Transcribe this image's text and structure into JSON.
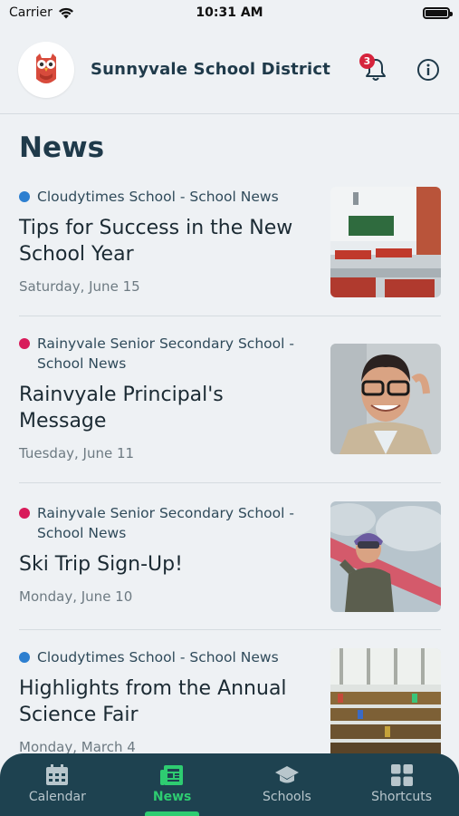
{
  "status_bar": {
    "carrier": "Carrier",
    "time": "10:31 AM"
  },
  "header": {
    "title": "Sunnyvale School District",
    "notification_count": "3"
  },
  "page_title": "News",
  "news": [
    {
      "source": "Cloudytimes School - School News",
      "dot_color": "#2d7fd0",
      "title": "Tips for Success in the New School Year",
      "date": "Saturday, June 15",
      "image": "classroom"
    },
    {
      "source": "Rainyvale Senior Secondary School - School News",
      "dot_color": "#d81b5a",
      "title": "Rainvyale Principal's Message",
      "date": "Tuesday, June 11",
      "image": "principal"
    },
    {
      "source": "Rainyvale Senior Secondary School - School News",
      "dot_color": "#d81b5a",
      "title": "Ski Trip Sign-Up!",
      "date": "Monday, June 10",
      "image": "ski"
    },
    {
      "source": "Cloudytimes School - School News",
      "dot_color": "#2d7fd0",
      "title": "Highlights from the Annual Science Fair",
      "date": "Monday, March 4",
      "image": "library"
    }
  ],
  "tabs": [
    {
      "label": "Calendar",
      "icon": "calendar-icon",
      "active": false
    },
    {
      "label": "News",
      "icon": "newspaper-icon",
      "active": true
    },
    {
      "label": "Schools",
      "icon": "graduation-cap-icon",
      "active": false
    },
    {
      "label": "Shortcuts",
      "icon": "grid-icon",
      "active": false
    }
  ]
}
